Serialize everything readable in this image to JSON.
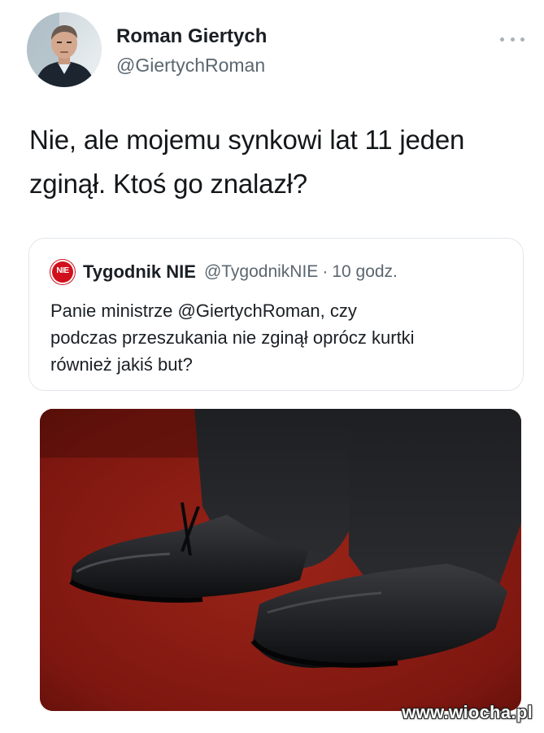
{
  "author": {
    "display_name": "Roman Giertych",
    "handle": "@GiertychRoman",
    "avatar_icon": "profile-photo"
  },
  "tweet": {
    "text_lines": [
      "Nie, ale mojemu synkowi lat 11 jeden",
      "zginął. Ktoś go znalazł?"
    ]
  },
  "quoted_tweet": {
    "avatar_label": "NIE",
    "display_name": "Tygodnik NIE",
    "handle": "@TygodnikNIE",
    "separator": "·",
    "time": "10 godz.",
    "text_lines": [
      "Panie ministrze @GiertychRoman, czy",
      "podczas przeszukania nie zginął oprócz kurtki",
      "również jakiś but?"
    ]
  },
  "media": {
    "description_icon": "photo-of-shoes"
  },
  "watermark": {
    "text": "www.wiocha.pl"
  },
  "colors": {
    "quote_logo_red": "#d0101c",
    "carpet_red": "#8a1a12",
    "muted_text": "#5b6770"
  }
}
